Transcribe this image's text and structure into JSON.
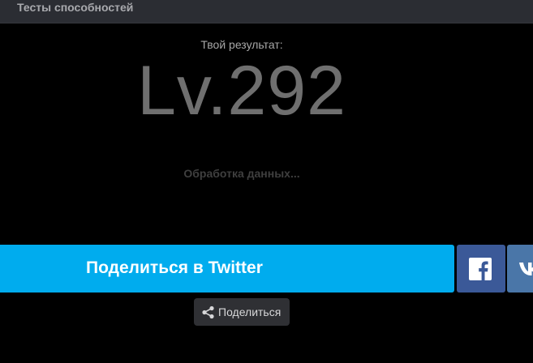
{
  "header": {
    "title": "Тесты способностей"
  },
  "result": {
    "label": "Твой результат:",
    "value": "Lv.292",
    "status": "Обработка данных..."
  },
  "share_buttons": {
    "twitter_label": "Поделиться в Twitter",
    "twitter_color": "#00acee",
    "facebook_icon": "facebook-icon",
    "facebook_color": "#3b5998",
    "vk_icon": "vk-icon",
    "vk_color": "#4a76a8"
  },
  "share": {
    "label": "Поделиться",
    "icon": "share-icon"
  }
}
